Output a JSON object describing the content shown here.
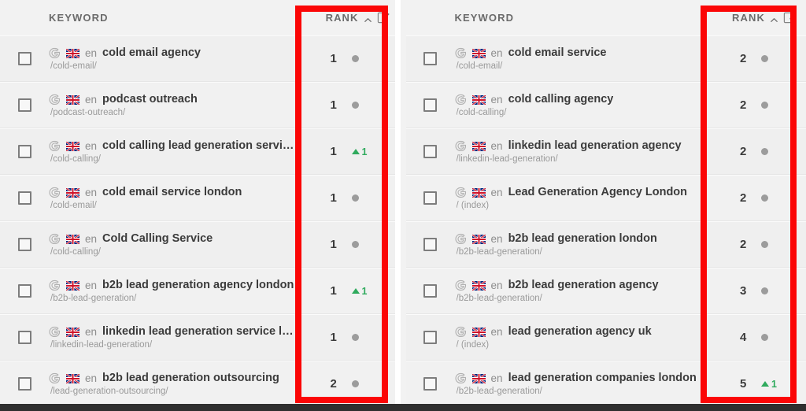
{
  "columns": {
    "keyword_label": "KEYWORD",
    "rank_label": "RANK",
    "sort_direction": "asc",
    "sort_icon": "chevron-up-icon",
    "edit_icon": "edit-pencil-icon"
  },
  "colors": {
    "annotation": "#fb0606",
    "increase": "#2faa5d",
    "neutral_dot": "#9c9c9c",
    "row_bg": "#efefef",
    "header_text": "#6b6b6b",
    "keyword_text": "#3b3b3b",
    "url_text": "#9a9a9a"
  },
  "left_panel": {
    "rows": [
      {
        "engine": "G",
        "country": "uk-flag",
        "lang": "en",
        "keyword": "cold email agency",
        "url": "/cold-email/",
        "rank": "1",
        "change_type": "none",
        "change": ""
      },
      {
        "engine": "G",
        "country": "uk-flag",
        "lang": "en",
        "keyword": "podcast outreach",
        "url": "/podcast-outreach/",
        "rank": "1",
        "change_type": "none",
        "change": ""
      },
      {
        "engine": "G",
        "country": "uk-flag",
        "lang": "en",
        "keyword": "cold calling lead generation services",
        "url": "/cold-calling/",
        "rank": "1",
        "change_type": "up",
        "change": "1"
      },
      {
        "engine": "G",
        "country": "uk-flag",
        "lang": "en",
        "keyword": "cold email service london",
        "url": "/cold-email/",
        "rank": "1",
        "change_type": "none",
        "change": ""
      },
      {
        "engine": "G",
        "country": "uk-flag",
        "lang": "en",
        "keyword": "Cold Calling Service",
        "url": "/cold-calling/",
        "rank": "1",
        "change_type": "none",
        "change": ""
      },
      {
        "engine": "G",
        "country": "uk-flag",
        "lang": "en",
        "keyword": "b2b lead generation agency london",
        "url": "/b2b-lead-generation/",
        "rank": "1",
        "change_type": "up",
        "change": "1"
      },
      {
        "engine": "G",
        "country": "uk-flag",
        "lang": "en",
        "keyword": "linkedin lead generation service london",
        "url": "/linkedin-lead-generation/",
        "rank": "1",
        "change_type": "none",
        "change": ""
      },
      {
        "engine": "G",
        "country": "uk-flag",
        "lang": "en",
        "keyword": "b2b lead generation outsourcing",
        "url": "/lead-generation-outsourcing/",
        "rank": "2",
        "change_type": "none",
        "change": ""
      }
    ]
  },
  "right_panel": {
    "rows": [
      {
        "engine": "G",
        "country": "uk-flag",
        "lang": "en",
        "keyword": "cold email service",
        "url": "/cold-email/",
        "rank": "2",
        "change_type": "none",
        "change": ""
      },
      {
        "engine": "G",
        "country": "uk-flag",
        "lang": "en",
        "keyword": "cold calling agency",
        "url": "/cold-calling/",
        "rank": "2",
        "change_type": "none",
        "change": ""
      },
      {
        "engine": "G",
        "country": "uk-flag",
        "lang": "en",
        "keyword": "linkedin lead generation agency",
        "url": "/linkedin-lead-generation/",
        "rank": "2",
        "change_type": "none",
        "change": ""
      },
      {
        "engine": "G",
        "country": "uk-flag",
        "lang": "en",
        "keyword": "Lead Generation Agency London",
        "url": "/ (index)",
        "rank": "2",
        "change_type": "none",
        "change": ""
      },
      {
        "engine": "G",
        "country": "uk-flag",
        "lang": "en",
        "keyword": "b2b lead generation london",
        "url": "/b2b-lead-generation/",
        "rank": "2",
        "change_type": "none",
        "change": ""
      },
      {
        "engine": "G",
        "country": "uk-flag",
        "lang": "en",
        "keyword": "b2b lead generation agency",
        "url": "/b2b-lead-generation/",
        "rank": "3",
        "change_type": "none",
        "change": ""
      },
      {
        "engine": "G",
        "country": "uk-flag",
        "lang": "en",
        "keyword": "lead generation agency uk",
        "url": "/ (index)",
        "rank": "4",
        "change_type": "none",
        "change": ""
      },
      {
        "engine": "G",
        "country": "uk-flag",
        "lang": "en",
        "keyword": "lead generation companies london",
        "url": "/b2b-lead-generation/",
        "rank": "5",
        "change_type": "up",
        "change": "1"
      }
    ]
  }
}
